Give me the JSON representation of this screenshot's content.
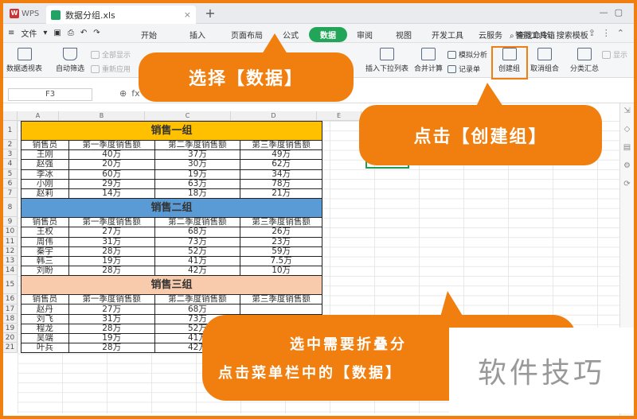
{
  "titlebar": {
    "app": "WPS",
    "file_tab": "数据分组.xls",
    "close": "×",
    "new_tab": "+"
  },
  "menubar": {
    "file": "文件",
    "tabs": [
      "开始",
      "插入",
      "页面布局",
      "公式",
      "数据",
      "审阅",
      "视图",
      "开发工具",
      "云服务",
      "智能工具箱"
    ],
    "active_tab": "数据",
    "search": "查找命令、搜索模板"
  },
  "ribbon": {
    "pivot": "数据透视表",
    "autofilter": "自动筛选",
    "show_all": "全部显示",
    "reapply": "重新应用",
    "insert_dropdown": "插入下拉列表",
    "consolidate": "合并计算",
    "whatif": "模拟分析",
    "record": "记录单",
    "create_group": "创建组",
    "ungroup": "取消组合",
    "subtotal": "分类汇总",
    "show_detail": "显示"
  },
  "formula": {
    "cell_ref": "F3",
    "fx": "fx"
  },
  "grid": {
    "columns": [
      "A",
      "B",
      "C",
      "D",
      "E"
    ],
    "rows": [
      "1",
      "2",
      "3",
      "4",
      "5",
      "6",
      "7",
      "8",
      "9",
      "10",
      "11",
      "12",
      "13",
      "14",
      "15",
      "16",
      "17",
      "18",
      "19",
      "20",
      "21"
    ]
  },
  "table": {
    "headers": [
      "销售员",
      "第一季度销售额",
      "第二季度销售额",
      "第三季度销售额"
    ],
    "groups": [
      {
        "title": "销售一组",
        "rows": [
          [
            "王刚",
            "40万",
            "37万",
            "49万"
          ],
          [
            "赵强",
            "20万",
            "30万",
            "62万"
          ],
          [
            "李冰",
            "60万",
            "19万",
            "34万"
          ],
          [
            "小刚",
            "29万",
            "63万",
            "78万"
          ],
          [
            "赵莉",
            "14万",
            "18万",
            "21万"
          ]
        ]
      },
      {
        "title": "销售二组",
        "rows": [
          [
            "王权",
            "27万",
            "68万",
            "26万"
          ],
          [
            "周伟",
            "31万",
            "73万",
            "23万"
          ],
          [
            "秦宇",
            "28万",
            "52万",
            "59万"
          ],
          [
            "韩三",
            "19万",
            "41万",
            "7.5万"
          ],
          [
            "刘盼",
            "28万",
            "42万",
            "10万"
          ]
        ]
      },
      {
        "title": "销售三组",
        "rows": [
          [
            "赵丹",
            "27万",
            "68万",
            ""
          ],
          [
            "刘飞",
            "31万",
            "73万",
            ""
          ],
          [
            "程龙",
            "28万",
            "52万",
            ""
          ],
          [
            "吴端",
            "19万",
            "41万",
            ""
          ],
          [
            "叶兵",
            "28万",
            "42万",
            ""
          ]
        ]
      }
    ]
  },
  "callouts": {
    "c1": "选择【数据】",
    "c2": "点击【创建组】",
    "c3_line1": "选中需要折叠分",
    "c3_line2": "点击菜单栏中的【数据】"
  },
  "watermark": "软件技巧",
  "accent": "#f07f0f"
}
